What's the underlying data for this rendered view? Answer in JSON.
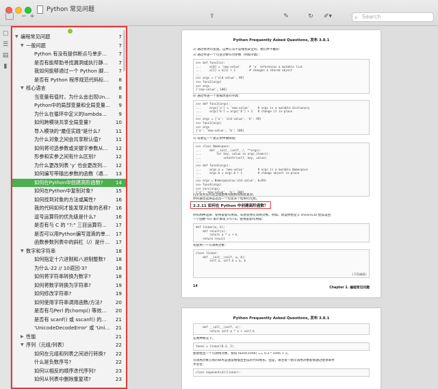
{
  "window": {
    "title": "Python 常见问题"
  },
  "toolbar": {
    "search_placeholder": "Search"
  },
  "toc": [
    {
      "label": "编程常见问题",
      "page": "7",
      "indent": 0,
      "caret": "▼"
    },
    {
      "label": "一般问题",
      "page": "7",
      "indent": 1,
      "caret": "▼"
    },
    {
      "label": "Python 有没有提供断点与单步调试等...",
      "page": "7",
      "indent": 2
    },
    {
      "label": "是否有能帮助寻找漏洞或执行静态分析...",
      "page": "7",
      "indent": 2
    },
    {
      "label": "我如何能够通过一个 Python 脚本创建...",
      "page": "7",
      "indent": 2
    },
    {
      "label": "是否有 Python 程序规范代码标准或风...",
      "page": "8",
      "indent": 2
    },
    {
      "label": "核心语言",
      "page": "8",
      "indent": 1,
      "caret": "▼"
    },
    {
      "label": "当变量有值时，为什么会出现UnboundL...",
      "page": "8",
      "indent": 2
    },
    {
      "label": "Python中的局部变量和全局变量有哪些...",
      "page": "9",
      "indent": 2
    },
    {
      "label": "为什么在循环中定义的lambda...",
      "page": "9",
      "indent": 2
    },
    {
      "label": "如何跨模块共享全局变量?",
      "page": "10",
      "indent": 2
    },
    {
      "label": "导入模块的\"最佳实践\"是什么?",
      "page": "11",
      "indent": 2
    },
    {
      "label": "为什么对象之间会共享默认值?",
      "page": "11",
      "indent": 2
    },
    {
      "label": "如何将可选参数或关键字参数从一个函...",
      "page": "12",
      "indent": 2
    },
    {
      "label": "形参和实参之间有什么区别?",
      "page": "12",
      "indent": 2
    },
    {
      "label": "为什么更改列表 'y' 也会更改列表 'x'?",
      "page": "12",
      "indent": 2
    },
    {
      "label": "如何编写带输出参数的函数（通过引用...",
      "page": "13",
      "indent": 2
    },
    {
      "label": "如何在Python中创建高阶函数?",
      "page": "14",
      "indent": 2,
      "active": true
    },
    {
      "label": "如何在Python中复制对象?",
      "page": "15",
      "indent": 2
    },
    {
      "label": "如何找到对象的方法或属性?",
      "page": "16",
      "indent": 2
    },
    {
      "label": "我的代码如何才能发现对象的名称?",
      "page": "16",
      "indent": 2
    },
    {
      "label": "逗号运算符的优先级是什么?",
      "page": "16",
      "indent": 2
    },
    {
      "label": "是否有与 C 的 \"?:\" 三目运算符等价的...",
      "page": "17",
      "indent": 2
    },
    {
      "label": "是否可以用Python编写混淆的单行程序?",
      "page": "17",
      "indent": 2
    },
    {
      "label": "函数参数列表中的斜杠（/）是什么意思?",
      "page": "17",
      "indent": 2
    },
    {
      "label": "数字和字符串",
      "page": "18",
      "indent": 1,
      "caret": "▼"
    },
    {
      "label": "如何指定十六进制和八进制整数?",
      "page": "18",
      "indent": 2
    },
    {
      "label": "为什么-22 // 10返回-3?",
      "page": "18",
      "indent": 2
    },
    {
      "label": "如何将字符串转换为数字?",
      "page": "18",
      "indent": 2
    },
    {
      "label": "如何将数字转换为字符串?",
      "page": "19",
      "indent": 2
    },
    {
      "label": "如何修改字符串?",
      "page": "19",
      "indent": 2
    },
    {
      "label": "如何使用字符串调用函数/方法?",
      "page": "20",
      "indent": 2
    },
    {
      "label": "是否有与Perl 的chomp() 等效的方法...",
      "page": "20",
      "indent": 2
    },
    {
      "label": "是否有 scanf() 或 sscanf() 的对应物?",
      "page": "21",
      "indent": 2
    },
    {
      "label": "'UnicodeDecodeError' 或 'UnicodeEnc...",
      "page": "21",
      "indent": 2
    },
    {
      "label": "性能",
      "page": "21",
      "indent": 1,
      "caret": "▶"
    },
    {
      "label": "序列（元组/列表）",
      "page": "22",
      "indent": 1,
      "caret": "▼"
    },
    {
      "label": "如何在元组和列表之间进行转换?",
      "page": "22",
      "indent": 2
    },
    {
      "label": "什么是负数序号?",
      "page": "22",
      "indent": 2
    },
    {
      "label": "如何以相反的顺序迭代序列?",
      "page": "23",
      "indent": 2
    },
    {
      "label": "如何从列表中删除重复项?",
      "page": "23",
      "indent": 2
    }
  ],
  "page1": {
    "header": "Python Frequently Asked Questions, 发布 3.8.1",
    "line_a": "2) 通过修改可变量。这种方法不是线程安全的，我们并不推荐：",
    "line_b": "3) 通过传递一个可变对象作为参数（例如字典）：",
    "code1": [
      ">>> def func2(a):",
      "...     a[0] = 'new-value'     # 'a' references a mutable list",
      "...     a[1] = a[1] + 1        # changes a shared object",
      "...",
      ">>> args = ['old-value', 99]",
      ">>> func2(args)",
      ">>> args",
      "['new-value', 100]"
    ],
    "line_c": "4) 通过传递一个会被改变的字典：",
    "code2": [
      ">>> def func3(args):",
      "...     args['a'] = 'new-value'     # args is a mutable dictionary",
      "...     args['b'] = args['b'] + 1   # change it in-place",
      "...",
      ">>> args = {'a': 'old-value', 'b': 99}",
      ">>> func3(args)",
      ">>> args",
      "{'a': 'new-value', 'b': 100}"
    ],
    "line_d": "5) 或者在一个类实例中捆绑值：",
    "code3": [
      ">>> class Namespace:",
      "...     def __init__(self, /, **args):",
      "...         for key, value in args.items():",
      "...             setattr(self, key, value)",
      "...",
      ">>> def func4(args):",
      "...     args.a = 'new-value'        # args is a mutable Namespace",
      "...     args.b = args.b + 1         # change object in-place",
      "...",
      ">>> args = Namespace(a='old-value', b=99)",
      ">>> func4(args)",
      ">>> vars(args)",
      "{'a': 'new-value', 'b': 100}"
    ],
    "line_e": "几乎没有任何适当理由将问题搞得如此复杂。",
    "line_f": "你的最佳选择是返回一个包含多个结果的元组。",
    "section_title": "2.2.11 如何在 Python 中创建高阶函数？",
    "line_g": "你有两种选择：使用嵌套作用域，或者使用可调用对象。例如，假设你想定义 linear(a,b) 使其返回",
    "line_h": "一个函数 f(x) 来计算值 a*x+b。使用嵌套作用域：",
    "code4": [
      "def linear(a, b):",
      "    def result(x):",
      "        return a * x + b",
      "    return result"
    ],
    "line_i": "或使用一个可调用对象：",
    "code5": [
      "class linear:",
      "",
      "    def __init__(self, a, b):",
      "        self.a, self.b = a, b"
    ],
    "code5_note": "(下页继续)",
    "footer_left": "14",
    "footer_right": "Chapter 2.  编程常见问题"
  },
  "page2": {
    "header": "Python Frequently Asked Questions, 发布 3.8.1",
    "code1": [
      "    def __call__(self, x):",
      "        return self.a * x + self.b"
    ],
    "line_a": "在两种情况下，",
    "code2": [
      "taxes = linear(0.3, 2)"
    ],
    "line_b": "都会给出一个可调用对象，使得 taxes(10e6) == 0.3 * 10e6 + 2。",
    "line_c": "可调用对象方式的缺点是速度略慢且生成的代码略长。但是，请注意一组可调用对象能够通过继承来共",
    "line_d": "享签名：",
    "code3": [
      "class exponential(linear):"
    ]
  }
}
